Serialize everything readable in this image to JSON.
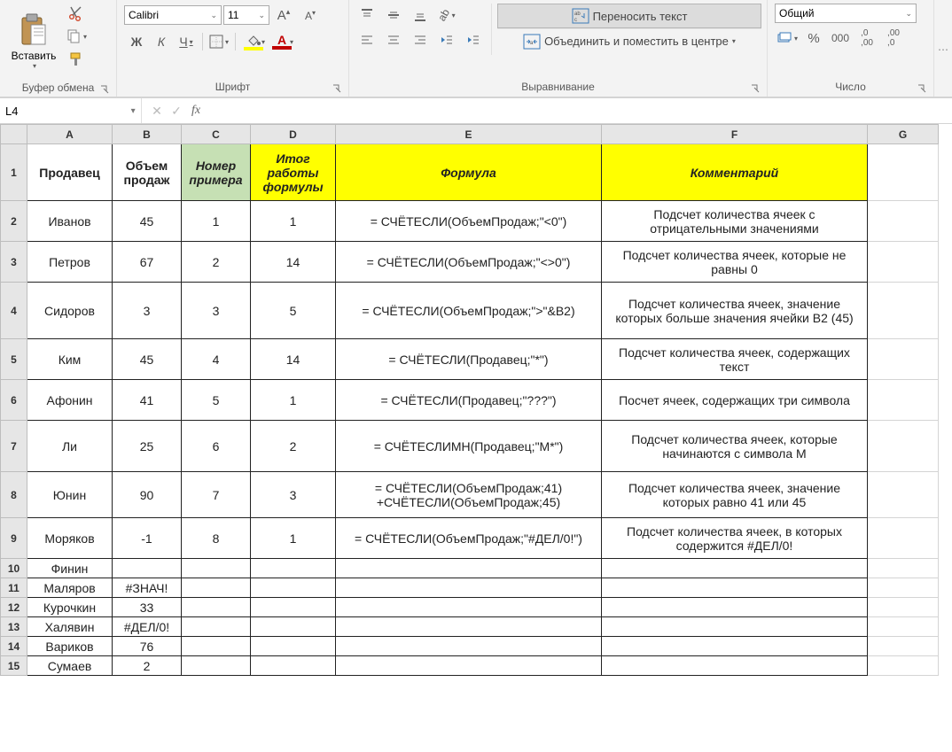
{
  "ribbon": {
    "clipboard": {
      "label": "Буфер обмена",
      "paste": "Вставить"
    },
    "font": {
      "label": "Шрифт",
      "name": "Calibri",
      "size": "11",
      "bold": "Ж",
      "italic": "К",
      "underline": "Ч"
    },
    "alignment": {
      "label": "Выравнивание",
      "wrap": "Переносить текст",
      "merge": "Объединить и поместить в центре"
    },
    "number": {
      "label": "Число",
      "format": "Общий",
      "fx_label": "fx"
    }
  },
  "namebox": "L4",
  "columns": [
    "A",
    "B",
    "C",
    "D",
    "E",
    "F",
    "G"
  ],
  "headers": {
    "A": "Продавец",
    "B": "Объем продаж",
    "C": "Номер примера",
    "D": "Итог работы формулы",
    "E": "Формула",
    "F": "Комментарий"
  },
  "rows": [
    {
      "n": 2,
      "A": "Иванов",
      "B": "45",
      "C": "1",
      "D": "1",
      "E": "= СЧЁТЕСЛИ(ОбъемПродаж;\"<0\")",
      "F": "Подсчет количества ячеек с отрицательными значениями"
    },
    {
      "n": 3,
      "A": "Петров",
      "B": "67",
      "C": "2",
      "D": "14",
      "E": "= СЧЁТЕСЛИ(ОбъемПродаж;\"<>0\")",
      "F": "Подсчет количества ячеек, которые не равны 0"
    },
    {
      "n": 4,
      "A": "Сидоров",
      "B": "3",
      "C": "3",
      "D": "5",
      "E": "= СЧЁТЕСЛИ(ОбъемПродаж;\">\"&B2)",
      "F": "Подсчет количества ячеек, значение которых больше значения ячейки B2 (45)"
    },
    {
      "n": 5,
      "A": "Ким",
      "B": "45",
      "C": "4",
      "D": "14",
      "E": "= СЧЁТЕСЛИ(Продавец;\"*\")",
      "F": "Подсчет количества ячеек, содержащих текст"
    },
    {
      "n": 6,
      "A": "Афонин",
      "B": "41",
      "C": "5",
      "D": "1",
      "E": "= СЧЁТЕСЛИ(Продавец;\"???\")",
      "F": "Посчет ячеек, содержащих три символа"
    },
    {
      "n": 7,
      "A": "Ли",
      "B": "25",
      "C": "6",
      "D": "2",
      "E": "= СЧЁТЕСЛИМН(Продавец;\"М*\")",
      "F": "Подсчет количества ячеек, которые начинаются с символа М"
    },
    {
      "n": 8,
      "A": "Юнин",
      "B": "90",
      "C": "7",
      "D": "3",
      "E": "= СЧЁТЕСЛИ(ОбъемПродаж;41) +СЧЁТЕСЛИ(ОбъемПродаж;45)",
      "F": "Подсчет количества ячеек, значение которых равно 41 или 45"
    },
    {
      "n": 9,
      "A": "Моряков",
      "B": "-1",
      "C": "8",
      "D": "1",
      "E": "= СЧЁТЕСЛИ(ОбъемПродаж;\"#ДЕЛ/0!\")",
      "F": "Подсчет количества ячеек, в которых содержится #ДЕЛ/0!"
    },
    {
      "n": 10,
      "A": "Финин",
      "B": "",
      "C": "",
      "D": "",
      "E": "",
      "F": ""
    },
    {
      "n": 11,
      "A": "Маляров",
      "B": "#ЗНАЧ!",
      "C": "",
      "D": "",
      "E": "",
      "F": ""
    },
    {
      "n": 12,
      "A": "Курочкин",
      "B": "33",
      "C": "",
      "D": "",
      "E": "",
      "F": ""
    },
    {
      "n": 13,
      "A": "Халявин",
      "B": "#ДЕЛ/0!",
      "C": "",
      "D": "",
      "E": "",
      "F": ""
    },
    {
      "n": 14,
      "A": "Вариков",
      "B": "76",
      "C": "",
      "D": "",
      "E": "",
      "F": ""
    },
    {
      "n": 15,
      "A": "Сумаев",
      "B": "2",
      "C": "",
      "D": "",
      "E": "",
      "F": ""
    }
  ]
}
